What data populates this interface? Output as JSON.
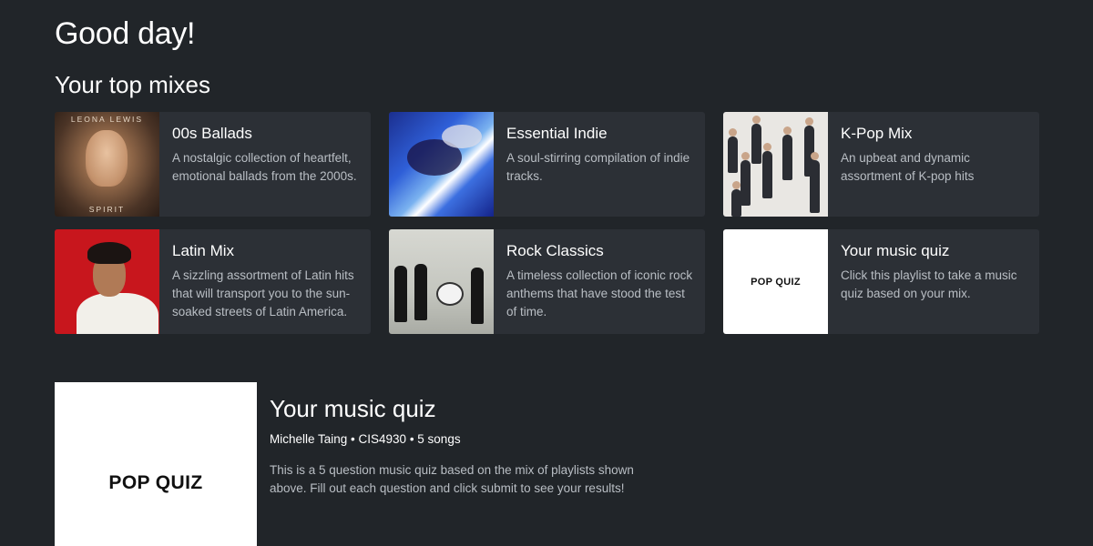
{
  "greeting": "Good day!",
  "section_title": "Your top mixes",
  "mixes": [
    {
      "title": "00s Ballads",
      "description": "A nostalgic collection of heartfelt, emotional ballads from the 2000s.",
      "cover_top_text": "LEONA LEWIS",
      "cover_bottom_text": "SPIRIT"
    },
    {
      "title": "Essential Indie",
      "description": "A soul-stirring compilation of indie tracks."
    },
    {
      "title": "K-Pop Mix",
      "description": "An upbeat and dynamic assortment of K-pop hits"
    },
    {
      "title": "Latin Mix",
      "description": "A sizzling assortment of Latin hits that will transport you to the sun-soaked streets of Latin America."
    },
    {
      "title": "Rock Classics",
      "description": "A timeless collection of iconic rock anthems that have stood the test of time."
    },
    {
      "title": "Your music quiz",
      "description": "Click this playlist to take a music quiz based on your mix.",
      "cover_text": "POP QUIZ"
    }
  ],
  "hero": {
    "cover_text": "POP QUIZ",
    "title": "Your music quiz",
    "meta": "Michelle Taing • CIS4930 • 5 songs",
    "description": "This is a 5 question music quiz based on the mix of playlists shown above. Fill out each question and click submit to see your results!"
  },
  "colors": {
    "background": "#212529",
    "card": "#2c3036",
    "muted_text": "#b9bec4",
    "latin_red": "#c8161d"
  }
}
